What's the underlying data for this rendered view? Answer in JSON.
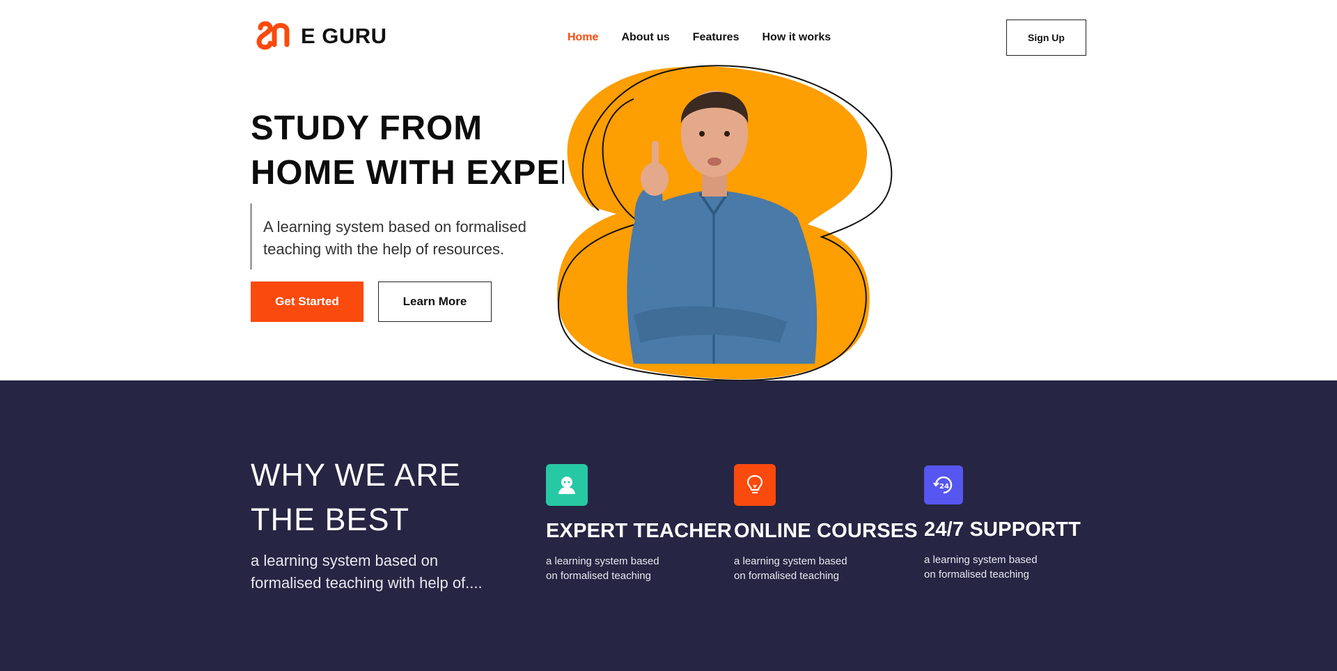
{
  "brand": {
    "name": "E GURU",
    "accent": "#fb4a0e"
  },
  "nav": {
    "items": [
      {
        "label": "Home",
        "active": true
      },
      {
        "label": "About us",
        "active": false
      },
      {
        "label": "Features",
        "active": false
      },
      {
        "label": "How it works",
        "active": false
      }
    ],
    "signup_label": "Sign Up"
  },
  "hero": {
    "title_line1": "STUDY FROM",
    "title_line2": "HOME WITH EXPERT",
    "description": "A learning system based on formalised teaching with the help of resources.",
    "primary_button": "Get Started",
    "secondary_button": "Learn More",
    "blob_color": "#fd9e02"
  },
  "why": {
    "title_line1": "WHY WE ARE",
    "title_line2": "THE BEST",
    "description": "a learning system based on formalised teaching with help of....",
    "background": "#262543"
  },
  "features": [
    {
      "title": "EXPERT TEACHER",
      "text": "a learning system based on formalised teaching",
      "icon": "teacher-icon",
      "color": "#27c9a4"
    },
    {
      "title": "ONLINE COURSES",
      "text": "a learning system based on formalised teaching",
      "icon": "lightbulb-icon",
      "color": "#fb4a0e"
    },
    {
      "title": "24/7 SUPPORTT",
      "text": "a learning system based on formalised teaching",
      "icon": "support-24-icon",
      "color": "#5656f0"
    }
  ]
}
